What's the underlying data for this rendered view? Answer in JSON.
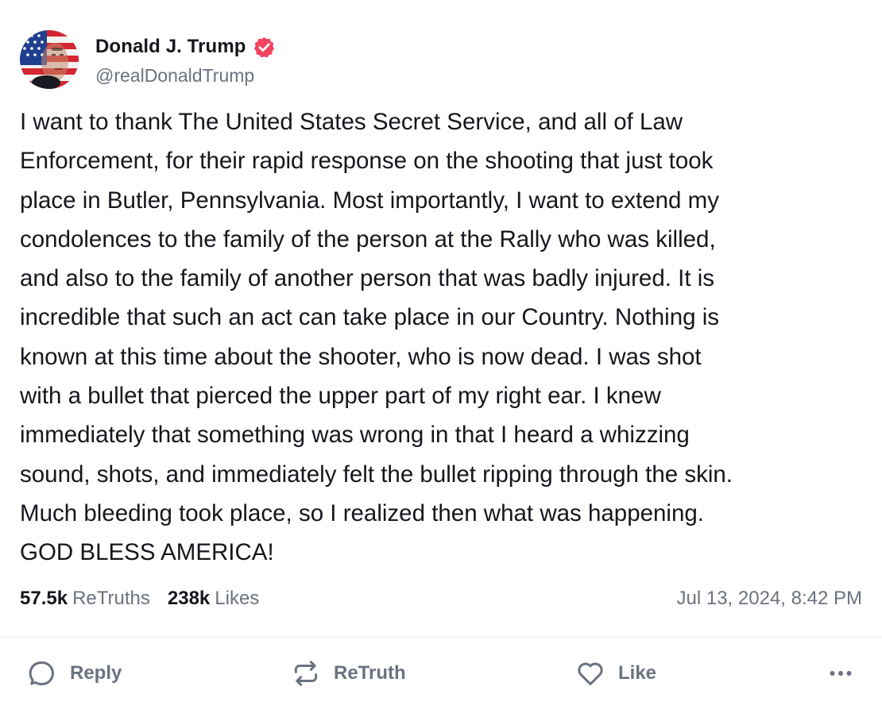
{
  "user": {
    "display_name": "Donald J. Trump",
    "handle": "@realDonaldTrump",
    "verified": true,
    "verified_color": "#f0445f",
    "avatar_icon": "flag-portrait-avatar"
  },
  "post": {
    "text": "I want to thank The United States Secret Service, and all of Law\nEnforcement, for their rapid response on the shooting that just took\nplace in Butler, Pennsylvania. Most importantly, I want to extend my\ncondolences to the family of the person at the Rally who was killed,\nand also to the family of another person that was badly injured. It is\nincredible that such an act can take place in our Country. Nothing is\nknown at this time about the shooter, who is now dead. I was shot\nwith a bullet that pierced the upper part of my right ear. I knew\nimmediately that something was wrong in that I heard a whizzing\nsound, shots, and immediately felt the bullet ripping through the skin.\nMuch bleeding took place, so I realized then what was happening.\nGOD BLESS AMERICA!",
    "timestamp": "Jul 13, 2024, 8:42 PM"
  },
  "stats": {
    "retruths_count": "57.5k",
    "retruths_label": "ReTruths",
    "likes_count": "238k",
    "likes_label": "Likes"
  },
  "actions": {
    "reply_label": "Reply",
    "retruth_label": "ReTruth",
    "like_label": "Like",
    "reply_icon": "speech-bubble-icon",
    "retruth_icon": "repost-arrows-icon",
    "like_icon": "heart-icon",
    "more_icon": "ellipsis-icon"
  },
  "colors": {
    "text": "#14171c",
    "muted": "#6b7280",
    "divider": "#e5e7eb"
  }
}
